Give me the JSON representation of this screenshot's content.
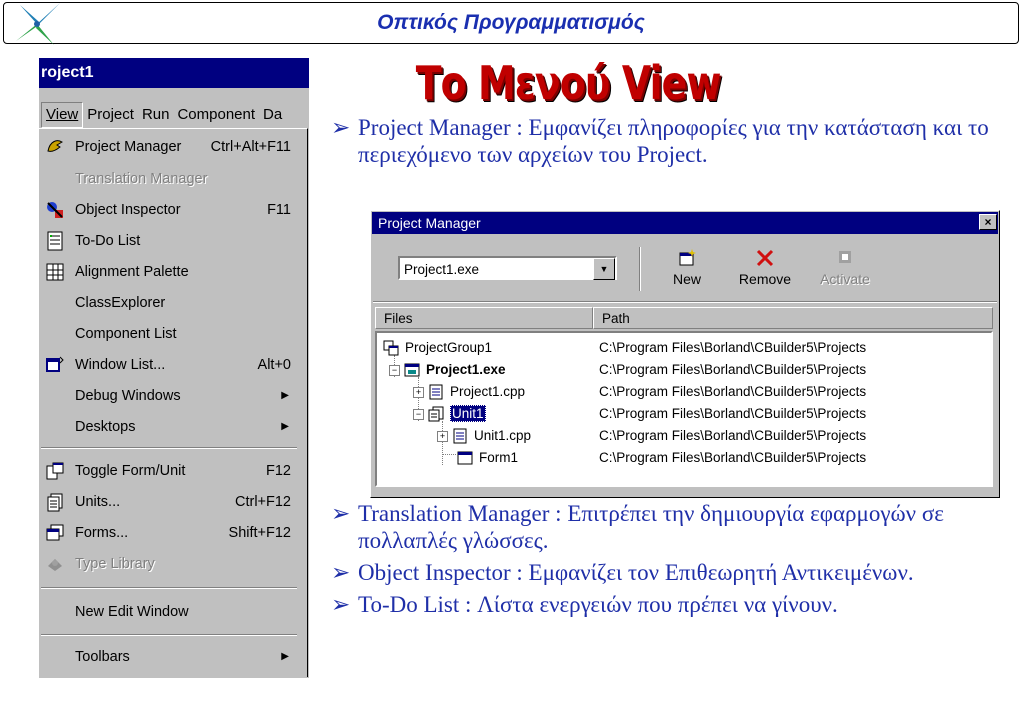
{
  "header": {
    "title": "Οπτικός Προγραμματισμός",
    "logo_icon": "star-logo-icon"
  },
  "slide_title": "Το Μενού View",
  "menu": {
    "window_title": "roject1",
    "menubar": [
      "View",
      "Project",
      "Run",
      "Component",
      "Da"
    ],
    "items": [
      {
        "label": "Project Manager",
        "shortcut": "Ctrl+Alt+F11",
        "icon": "project-manager-icon",
        "enabled": true
      },
      {
        "label": "Translation Manager",
        "shortcut": "",
        "icon": "",
        "enabled": false
      },
      {
        "label": "Object Inspector",
        "shortcut": "F11",
        "icon": "object-inspector-icon",
        "enabled": true
      },
      {
        "label": "To-Do List",
        "shortcut": "",
        "icon": "todo-list-icon",
        "enabled": true
      },
      {
        "label": "Alignment Palette",
        "shortcut": "",
        "icon": "alignment-palette-icon",
        "enabled": true
      },
      {
        "label": "ClassExplorer",
        "shortcut": "",
        "icon": "",
        "enabled": true
      },
      {
        "label": "Component List",
        "shortcut": "",
        "icon": "",
        "enabled": true
      },
      {
        "label": "Window List...",
        "shortcut": "Alt+0",
        "icon": "window-list-icon",
        "enabled": true
      },
      {
        "label": "Debug Windows",
        "shortcut": "",
        "icon": "",
        "enabled": true,
        "submenu": true
      },
      {
        "label": "Desktops",
        "shortcut": "",
        "icon": "",
        "enabled": true,
        "submenu": true
      },
      {
        "label": "Toggle Form/Unit",
        "shortcut": "F12",
        "icon": "toggle-form-unit-icon",
        "enabled": true
      },
      {
        "label": "Units...",
        "shortcut": "Ctrl+F12",
        "icon": "units-icon",
        "enabled": true
      },
      {
        "label": "Forms...",
        "shortcut": "Shift+F12",
        "icon": "forms-icon",
        "enabled": true
      },
      {
        "label": "Type Library",
        "shortcut": "",
        "icon": "type-library-icon",
        "enabled": false
      },
      {
        "label": "New Edit Window",
        "shortcut": "",
        "icon": "",
        "enabled": true
      },
      {
        "label": "Toolbars",
        "shortcut": "",
        "icon": "",
        "enabled": true,
        "submenu": true
      }
    ]
  },
  "bullets": {
    "first": "Project Manager : Εμφανίζει πληροφορίες για την κατάσταση και το περιεχόμενο των αρχείων του Project.",
    "rest": [
      "Translation Manager : Επιτρέπει την δημιουργία εφαρμογών σε πολλαπλές γλώσσες.",
      "Object Inspector : Εμφανίζει τον Επιθεωρητή Αντικειμένων.",
      "To-Do List : Λίστα ενεργειών που πρέπει να γίνουν."
    ]
  },
  "project_manager": {
    "title": "Project Manager",
    "close": "×",
    "combo_value": "Project1.exe",
    "buttons": {
      "new": "New",
      "remove": "Remove",
      "activate": "Activate"
    },
    "columns": {
      "files": "Files",
      "path": "Path"
    },
    "rows": [
      {
        "name": "ProjectGroup1",
        "path": "C:\\Program Files\\Borland\\CBuilder5\\Projects"
      },
      {
        "name": "Project1.exe",
        "path": "C:\\Program Files\\Borland\\CBuilder5\\Projects"
      },
      {
        "name": "Project1.cpp",
        "path": "C:\\Program Files\\Borland\\CBuilder5\\Projects"
      },
      {
        "name": "Unit1",
        "path": "C:\\Program Files\\Borland\\CBuilder5\\Projects"
      },
      {
        "name": "Unit1.cpp",
        "path": "C:\\Program Files\\Borland\\CBuilder5\\Projects"
      },
      {
        "name": "Form1",
        "path": "C:\\Program Files\\Borland\\CBuilder5\\Projects"
      }
    ]
  }
}
